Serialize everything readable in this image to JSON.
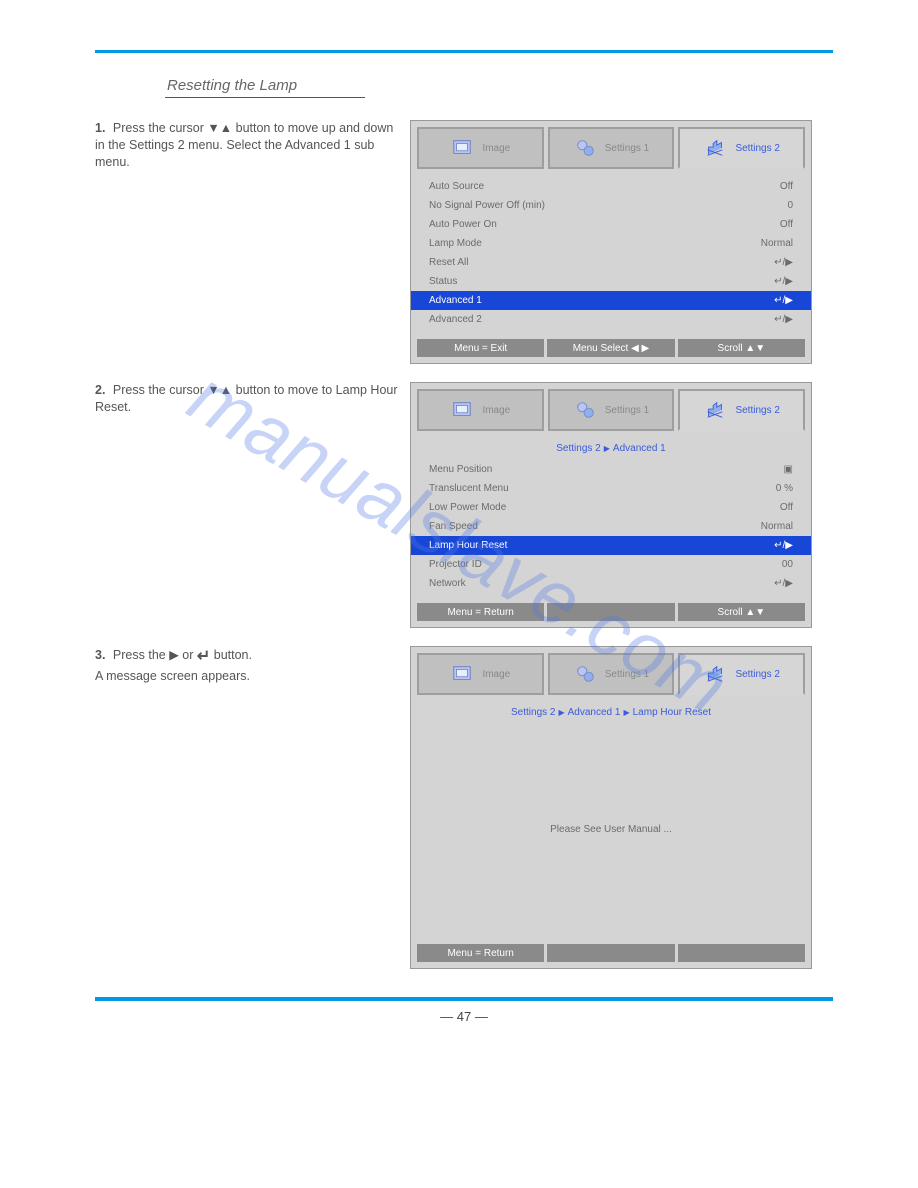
{
  "watermark": "manualslave.com",
  "section_title": "Resetting the Lamp",
  "page_number": "— 47 —",
  "steps": [
    {
      "num": "1.",
      "text": "Press the cursor ▼▲ button to move up and down in the Settings 2 menu. Select the Advanced 1 sub menu.",
      "enter_icon": false,
      "osd": {
        "tabs": [
          "Image",
          "Settings 1",
          "Settings 2"
        ],
        "active_tab": 2,
        "breadcrumb": null,
        "items": [
          {
            "label": "Auto Source",
            "value": "Off",
            "sel": false
          },
          {
            "label": "No Signal Power Off (min)",
            "value": "0",
            "sel": false
          },
          {
            "label": "Auto Power On",
            "value": "Off",
            "sel": false
          },
          {
            "label": "Lamp Mode",
            "value": "Normal",
            "sel": false
          },
          {
            "label": "Reset All",
            "value": "↵/▶",
            "sel": false
          },
          {
            "label": "Status",
            "value": "↵/▶",
            "sel": false
          },
          {
            "label": "Advanced 1",
            "value": "↵/▶",
            "sel": true
          },
          {
            "label": "Advanced 2",
            "value": "↵/▶",
            "sel": false
          }
        ],
        "footer": [
          "Menu = Exit",
          "Menu Select ◀ ▶",
          "Scroll ▲▼"
        ]
      }
    },
    {
      "num": "2.",
      "text": "Press the cursor ▼▲ button to move to Lamp Hour Reset.",
      "enter_icon": false,
      "osd": {
        "tabs": [
          "Image",
          "Settings 1",
          "Settings 2"
        ],
        "active_tab": 2,
        "breadcrumb": [
          "Settings 2",
          "Advanced 1"
        ],
        "items": [
          {
            "label": "Menu Position",
            "value": "▣",
            "sel": false
          },
          {
            "label": "Translucent Menu",
            "value": "0 %",
            "sel": false
          },
          {
            "label": "Low Power Mode",
            "value": "Off",
            "sel": false
          },
          {
            "label": "Fan Speed",
            "value": "Normal",
            "sel": false
          },
          {
            "label": "Lamp Hour Reset",
            "value": "↵/▶",
            "sel": true
          },
          {
            "label": "Projector ID",
            "value": "00",
            "sel": false
          },
          {
            "label": "Network",
            "value": "↵/▶",
            "sel": false
          }
        ],
        "footer": [
          "Menu = Return",
          "",
          "Scroll ▲▼"
        ]
      }
    },
    {
      "num": "3.",
      "text": "Press the ▶ or    button.\nA message screen appears.",
      "enter_icon": true,
      "osd": {
        "tabs": [
          "Image",
          "Settings 1",
          "Settings 2"
        ],
        "active_tab": 2,
        "breadcrumb": [
          "Settings 2",
          "Advanced 1",
          "Lamp Hour Reset"
        ],
        "empty_message": "Please See User Manual ...",
        "footer": [
          "Menu = Return",
          "",
          ""
        ]
      }
    }
  ]
}
